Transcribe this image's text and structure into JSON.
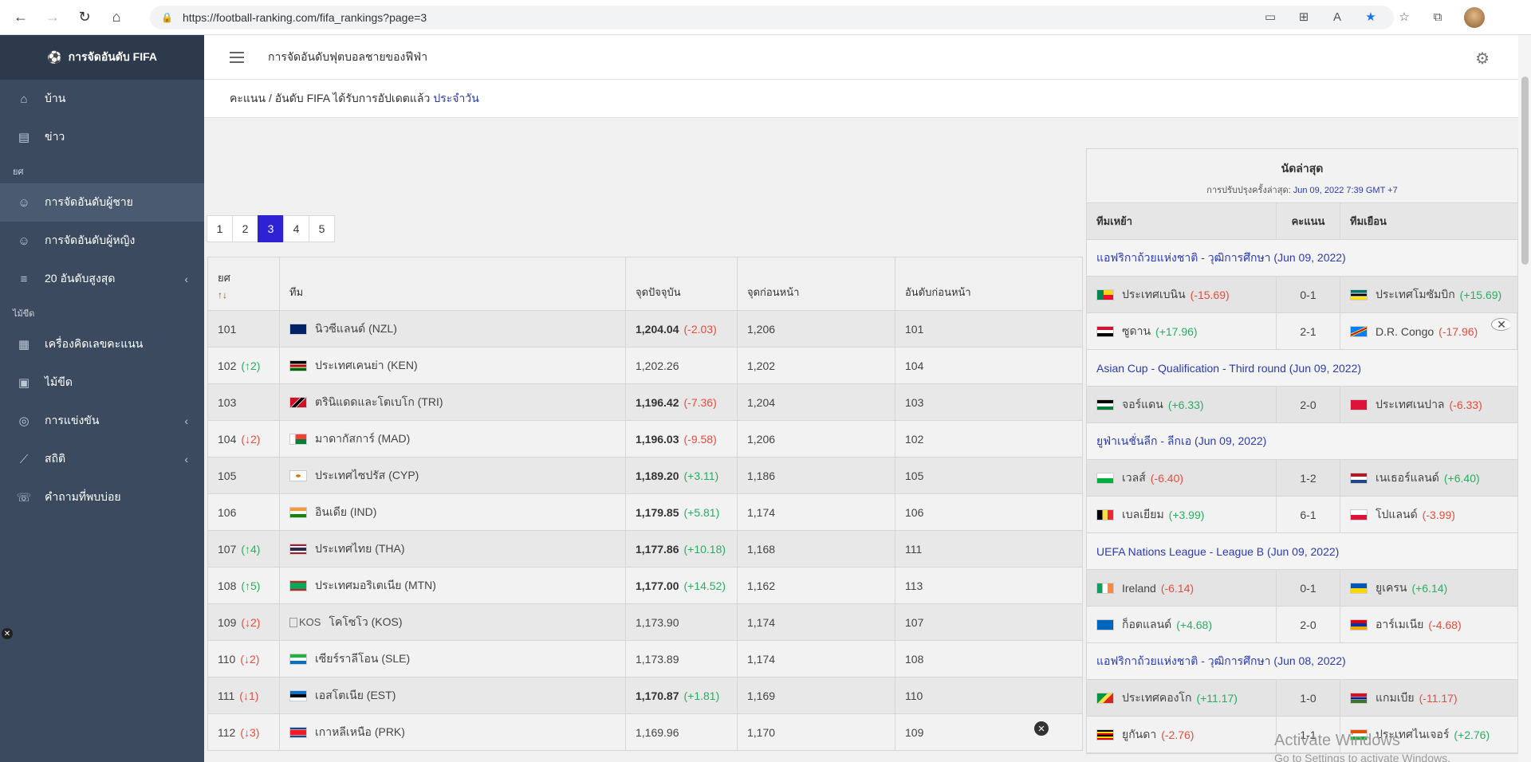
{
  "browser": {
    "url": "https://football-ranking.com/fifa_rankings?page=3"
  },
  "sidebar": {
    "brand": "การจัดอันดับ FIFA",
    "items_top": [
      {
        "label": "บ้าน",
        "icon": "home-icon",
        "glyph": "⌂"
      },
      {
        "label": "ข่าว",
        "icon": "newspaper-icon",
        "glyph": "▤"
      }
    ],
    "section_rank": "ยศ",
    "items_rank": [
      {
        "label": "การจัดอันดับผู้ชาย",
        "icon": "user-icon",
        "glyph": "☺",
        "active": true
      },
      {
        "label": "การจัดอันดับผู้หญิง",
        "icon": "user-icon",
        "glyph": "☺"
      },
      {
        "label": "20 อันดับสูงสุด",
        "icon": "sort-icon",
        "glyph": "≡",
        "chevron": true
      }
    ],
    "section_tools": "ไม้ขีด",
    "items_tools": [
      {
        "label": "เครื่องคิดเลขคะแนน",
        "icon": "calculator-icon",
        "glyph": "▦"
      },
      {
        "label": "ไม้ขีด",
        "icon": "calendar-icon",
        "glyph": "▣"
      },
      {
        "label": "การแข่งขัน",
        "icon": "soccer-ball-icon",
        "glyph": "◎",
        "chevron": true
      },
      {
        "label": "สถิติ",
        "icon": "chart-icon",
        "glyph": "⟋",
        "chevron": true
      },
      {
        "label": "คำถามที่พบบ่อย",
        "icon": "chat-icon",
        "glyph": "☏"
      }
    ]
  },
  "header": {
    "title": "การจัดอันดับฟุตบอลชายของฟีฟ่า"
  },
  "breadcrumb": {
    "text": "คะแนน / อันดับ FIFA ได้รับการอัปเดตแล้ว",
    "highlight": "ประจำวัน"
  },
  "pagination": {
    "pages": [
      "1",
      "2",
      "3",
      "4",
      "5"
    ],
    "active": "3"
  },
  "rankings": {
    "headers": {
      "rank": "ยศ",
      "sort": "↑↓",
      "team": "ทีม",
      "points": "จุดปัจจุบัน",
      "prev_points": "จุดก่อนหน้า",
      "prev_rank": "อันดับก่อนหน้า"
    },
    "rows": [
      {
        "rank": "101",
        "move": "",
        "dir": "",
        "flag": "nzl",
        "team": "นิวซีแลนด์ (NZL)",
        "pts": "1,204.04",
        "diff": "(-2.03)",
        "diff_dir": "down",
        "bold": true,
        "prev": "1,206",
        "prank": "101"
      },
      {
        "rank": "102",
        "move": "(↑2)",
        "dir": "up",
        "flag": "ken",
        "team": "ประเทศเคนย่า (KEN)",
        "pts": "1,202.26",
        "diff": "",
        "diff_dir": "",
        "bold": false,
        "prev": "1,202",
        "prank": "104"
      },
      {
        "rank": "103",
        "move": "",
        "dir": "",
        "flag": "tri",
        "team": "ตรินิแดดและโตเบโก (TRI)",
        "pts": "1,196.42",
        "diff": "(-7.36)",
        "diff_dir": "down",
        "bold": true,
        "prev": "1,204",
        "prank": "103"
      },
      {
        "rank": "104",
        "move": "(↓2)",
        "dir": "down",
        "flag": "mad",
        "team": "มาดากัสการ์ (MAD)",
        "pts": "1,196.03",
        "diff": "(-9.58)",
        "diff_dir": "down",
        "bold": true,
        "prev": "1,206",
        "prank": "102"
      },
      {
        "rank": "105",
        "move": "",
        "dir": "",
        "flag": "cyp",
        "team": "ประเทศไซปรัส (CYP)",
        "pts": "1,189.20",
        "diff": "(+3.11)",
        "diff_dir": "up",
        "bold": true,
        "prev": "1,186",
        "prank": "105"
      },
      {
        "rank": "106",
        "move": "",
        "dir": "",
        "flag": "ind",
        "team": "อินเดีย (IND)",
        "pts": "1,179.85",
        "diff": "(+5.81)",
        "diff_dir": "up",
        "bold": true,
        "prev": "1,174",
        "prank": "106"
      },
      {
        "rank": "107",
        "move": "(↑4)",
        "dir": "up",
        "flag": "tha",
        "team": "ประเทศไทย (THA)",
        "pts": "1,177.86",
        "diff": "(+10.18)",
        "diff_dir": "up",
        "bold": true,
        "prev": "1,168",
        "prank": "111"
      },
      {
        "rank": "108",
        "move": "(↑5)",
        "dir": "up",
        "flag": "mtn",
        "team": "ประเทศมอริเตเนีย (MTN)",
        "pts": "1,177.00",
        "diff": "(+14.52)",
        "diff_dir": "up",
        "bold": true,
        "prev": "1,162",
        "prank": "113"
      },
      {
        "rank": "109",
        "move": "(↓2)",
        "dir": "down",
        "flag": "broken",
        "flag_alt": "KOS",
        "team": "โคโซโว (KOS)",
        "pts": "1,173.90",
        "diff": "",
        "diff_dir": "",
        "bold": false,
        "prev": "1,174",
        "prank": "107"
      },
      {
        "rank": "110",
        "move": "(↓2)",
        "dir": "down",
        "flag": "sle",
        "team": "เซียร์ราลีโอน (SLE)",
        "pts": "1,173.89",
        "diff": "",
        "diff_dir": "",
        "bold": false,
        "prev": "1,174",
        "prank": "108"
      },
      {
        "rank": "111",
        "move": "(↓1)",
        "dir": "down",
        "flag": "est",
        "team": "เอสโตเนีย (EST)",
        "pts": "1,170.87",
        "diff": "(+1.81)",
        "diff_dir": "up",
        "bold": true,
        "prev": "1,169",
        "prank": "110"
      },
      {
        "rank": "112",
        "move": "(↓3)",
        "dir": "down",
        "flag": "prk",
        "team": "เกาหลีเหนือ (PRK)",
        "pts": "1,169.96",
        "diff": "",
        "diff_dir": "",
        "bold": false,
        "prev": "1,170",
        "prank": "109"
      }
    ]
  },
  "matches": {
    "title": "นัดล่าสุด",
    "updated_label": "การปรับปรุงครั้งล่าสุด:",
    "updated_value": "Jun 09, 2022 7:39 GMT +7",
    "headers": {
      "home": "ทีมเหย้า",
      "score": "คะแนน",
      "away": "ทีมเยือน"
    },
    "blocks": [
      {
        "comp": "แอฟริกาถ้วยแห่งชาติ - วุฒิการศึกษา (Jun 09, 2022)",
        "games": [
          {
            "home_flag": "ben",
            "home": "ประเทศเบนิน",
            "home_diff": "(-15.69)",
            "home_dir": "down",
            "score": "0-1",
            "away_flag": "moz",
            "away": "ประเทศโมซัมบิก",
            "away_diff": "(+15.69)",
            "away_dir": "up"
          },
          {
            "home_flag": "sud",
            "home": "ซูดาน",
            "home_diff": "(+17.96)",
            "home_dir": "up",
            "score": "2-1",
            "away_flag": "cod",
            "away": "D.R. Congo",
            "away_diff": "(-17.96)",
            "away_dir": "down"
          }
        ]
      },
      {
        "comp": "Asian Cup - Qualification - Third round (Jun 09, 2022)",
        "games": [
          {
            "home_flag": "jor",
            "home": "จอร์แดน",
            "home_diff": "(+6.33)",
            "home_dir": "up",
            "score": "2-0",
            "away_flag": "nep",
            "away": "ประเทศเนปาล",
            "away_diff": "(-6.33)",
            "away_dir": "down"
          }
        ]
      },
      {
        "comp": "ยูฟ่าเนชั่นลีก - ลีกเอ (Jun 09, 2022)",
        "games": [
          {
            "home_flag": "wal",
            "home": "เวลส์",
            "home_diff": "(-6.40)",
            "home_dir": "down",
            "score": "1-2",
            "away_flag": "ned",
            "away": "เนเธอร์แลนด์",
            "away_diff": "(+6.40)",
            "away_dir": "up"
          },
          {
            "home_flag": "bel",
            "home": "เบลเยียม",
            "home_diff": "(+3.99)",
            "home_dir": "up",
            "score": "6-1",
            "away_flag": "pol",
            "away": "โปแลนด์",
            "away_diff": "(-3.99)",
            "away_dir": "down"
          }
        ]
      },
      {
        "comp": "UEFA Nations League - League B (Jun 09, 2022)",
        "games": [
          {
            "home_flag": "irl",
            "home": "Ireland",
            "home_diff": "(-6.14)",
            "home_dir": "down",
            "score": "0-1",
            "away_flag": "ukr",
            "away": "ยูเครน",
            "away_diff": "(+6.14)",
            "away_dir": "up"
          },
          {
            "home_flag": "sco",
            "home": "ก็อตแลนด์",
            "home_diff": "(+4.68)",
            "home_dir": "up",
            "score": "2-0",
            "away_flag": "arm",
            "away": "อาร์เมเนีย",
            "away_diff": "(-4.68)",
            "away_dir": "down"
          }
        ]
      },
      {
        "comp": "แอฟริกาถ้วยแห่งชาติ - วุฒิการศึกษา (Jun 08, 2022)",
        "games": [
          {
            "home_flag": "cgo",
            "home": "ประเทศคองโก",
            "home_diff": "(+11.17)",
            "home_dir": "up",
            "score": "1-0",
            "away_flag": "gam",
            "away": "แกมเบีย",
            "away_diff": "(-11.17)",
            "away_dir": "down"
          },
          {
            "home_flag": "uga",
            "home": "ยูกันดา",
            "home_diff": "(-2.76)",
            "home_dir": "down",
            "score": "1-1",
            "away_flag": "nig",
            "away": "ประเทศไนเจอร์",
            "away_diff": "(+2.76)",
            "away_dir": "up"
          }
        ]
      }
    ]
  },
  "watermark": {
    "line1": "Activate Windows",
    "line2": "Go to Settings to activate Windows."
  },
  "colors": {
    "sidebar": "#3b4a5e",
    "active_page": "#2e22d4",
    "link": "#2b3bb0",
    "up": "#27ae60",
    "down": "#e74c3c"
  }
}
